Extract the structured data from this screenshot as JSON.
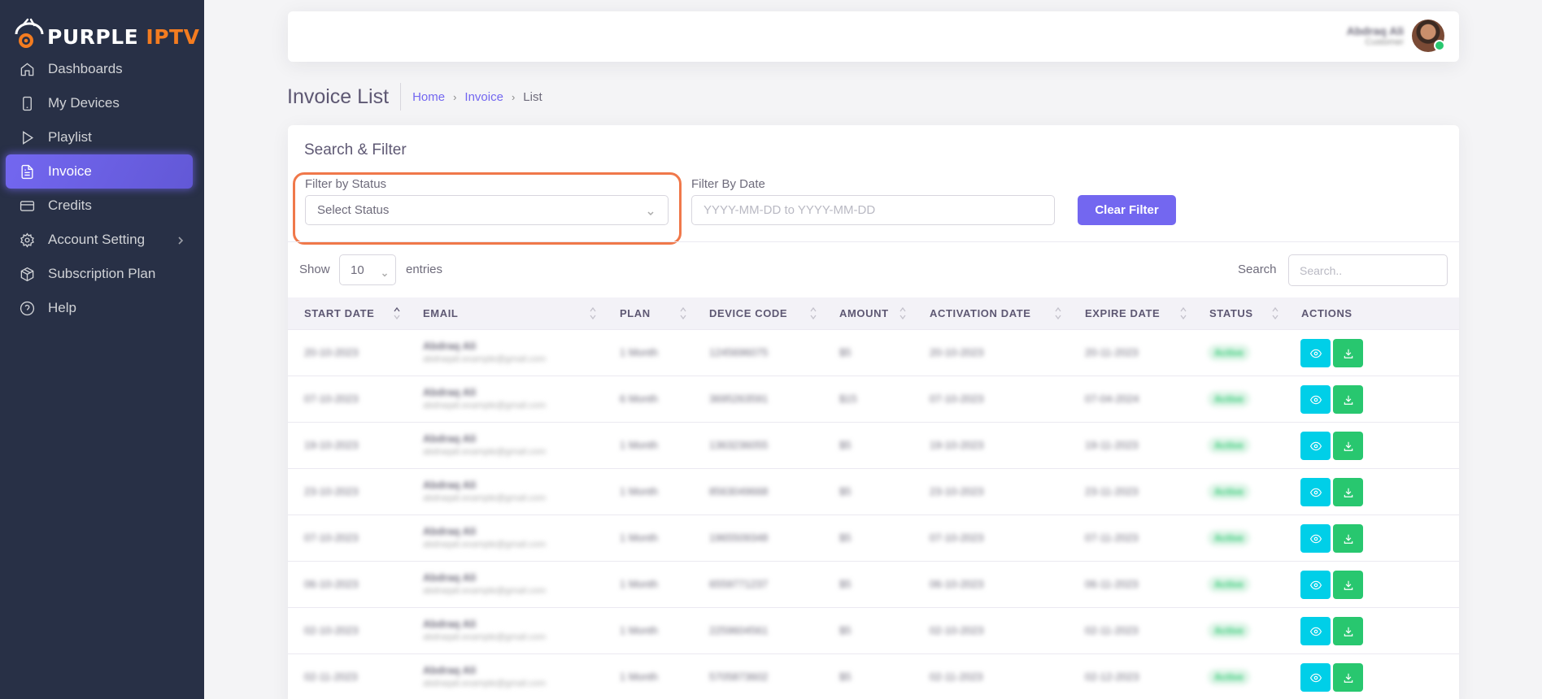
{
  "brand": {
    "word1": "PURPLE",
    "word2": " IPTV"
  },
  "sidebar": {
    "items": [
      {
        "label": "Dashboards",
        "icon": "home-icon"
      },
      {
        "label": "My Devices",
        "icon": "smartphone-icon"
      },
      {
        "label": "Playlist",
        "icon": "play-icon"
      },
      {
        "label": "Invoice",
        "icon": "file-text-icon",
        "active": true
      },
      {
        "label": "Credits",
        "icon": "credit-card-icon"
      },
      {
        "label": "Account Setting",
        "icon": "gear-icon",
        "has_submenu": true
      },
      {
        "label": "Subscription Plan",
        "icon": "package-icon"
      },
      {
        "label": "Help",
        "icon": "help-circle-icon"
      }
    ]
  },
  "user": {
    "name": "Abdraq Ali",
    "role": "Customer"
  },
  "page": {
    "title": "Invoice List"
  },
  "breadcrumb": {
    "home": "Home",
    "section": "Invoice",
    "current": "List"
  },
  "filter": {
    "card_title": "Search & Filter",
    "status_label": "Filter by Status",
    "status_value": "Select Status",
    "date_label": "Filter By Date",
    "date_placeholder": "YYYY-MM-DD to YYYY-MM-DD",
    "clear_label": "Clear Filter"
  },
  "table_controls": {
    "show_label": "Show",
    "page_length": "10",
    "entries_label": "entries",
    "search_label": "Search",
    "search_placeholder": "Search.."
  },
  "table": {
    "columns": [
      "START DATE",
      "EMAIL",
      "PLAN",
      "DEVICE CODE",
      "AMOUNT",
      "ACTIVATION DATE",
      "EXPIRE DATE",
      "STATUS",
      "ACTIONS"
    ],
    "rows": [
      {
        "start": "20-10-2023",
        "name": "Abdraq Ali",
        "email": "abdraqali.example@gmail.com",
        "plan": "1 Month",
        "device": "1245696075",
        "amount": "$5",
        "activation": "20-10-2023",
        "expire": "20-11-2023",
        "status": "Active"
      },
      {
        "start": "07-10-2023",
        "name": "Abdraq Ali",
        "email": "abdraqali.example@gmail.com",
        "plan": "6 Month",
        "device": "3695263591",
        "amount": "$15",
        "activation": "07-10-2023",
        "expire": "07-04-2024",
        "status": "Active"
      },
      {
        "start": "19-10-2023",
        "name": "Abdraq Ali",
        "email": "abdraqali.example@gmail.com",
        "plan": "1 Month",
        "device": "1363236055",
        "amount": "$5",
        "activation": "19-10-2023",
        "expire": "19-11-2023",
        "status": "Active"
      },
      {
        "start": "23-10-2023",
        "name": "Abdraq Ali",
        "email": "abdraqali.example@gmail.com",
        "plan": "1 Month",
        "device": "8563049668",
        "amount": "$5",
        "activation": "23-10-2023",
        "expire": "23-11-2023",
        "status": "Active"
      },
      {
        "start": "07-10-2023",
        "name": "Abdraq Ali",
        "email": "abdraqali.example@gmail.com",
        "plan": "1 Month",
        "device": "1965509348",
        "amount": "$5",
        "activation": "07-10-2023",
        "expire": "07-11-2023",
        "status": "Active"
      },
      {
        "start": "06-10-2023",
        "name": "Abdraq Ali",
        "email": "abdraqali.example@gmail.com",
        "plan": "1 Month",
        "device": "6559771237",
        "amount": "$5",
        "activation": "06-10-2023",
        "expire": "06-11-2023",
        "status": "Active"
      },
      {
        "start": "02-10-2023",
        "name": "Abdraq Ali",
        "email": "abdraqali.example@gmail.com",
        "plan": "1 Month",
        "device": "2259604561",
        "amount": "$5",
        "activation": "02-10-2023",
        "expire": "02-11-2023",
        "status": "Active"
      },
      {
        "start": "02-11-2023",
        "name": "Abdraq Ali",
        "email": "abdraqali.example@gmail.com",
        "plan": "1 Month",
        "device": "5705873602",
        "amount": "$5",
        "activation": "02-11-2023",
        "expire": "02-12-2023",
        "status": "Active"
      }
    ]
  },
  "colors": {
    "sidebar": "#283046",
    "accent": "#7367f0",
    "brand_orange": "#f47c20",
    "view_button": "#00cfe8",
    "download_button": "#28c76f",
    "highlight": "#f0784a"
  }
}
